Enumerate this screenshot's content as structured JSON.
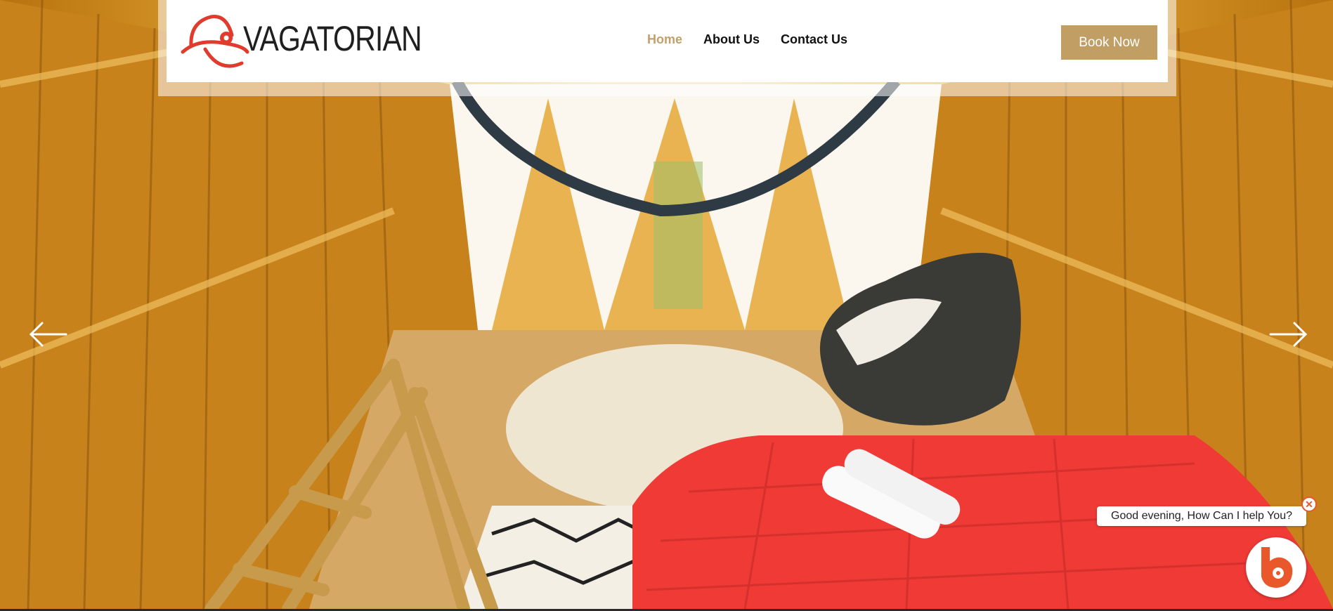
{
  "brand": {
    "name": "VAGATORIAN",
    "logo_icon": "hat-logo-icon",
    "logo_color": "#e03b2c"
  },
  "nav": {
    "items": [
      {
        "label": "Home",
        "active": true
      },
      {
        "label": "About Us",
        "active": false
      },
      {
        "label": "Contact Us",
        "active": false
      }
    ],
    "active_color": "#c2a06c"
  },
  "header": {
    "book_label": "Book Now",
    "book_color": "#c09e64"
  },
  "slider": {
    "prev_icon": "arrow-left-icon",
    "next_icon": "arrow-right-icon"
  },
  "chat": {
    "greeting": "Good evening, How Can I help You?",
    "close_icon": "close-icon",
    "close_symbol": "✕",
    "launcher_icon": "chat-bot-icon",
    "accent": "#e9572b"
  }
}
